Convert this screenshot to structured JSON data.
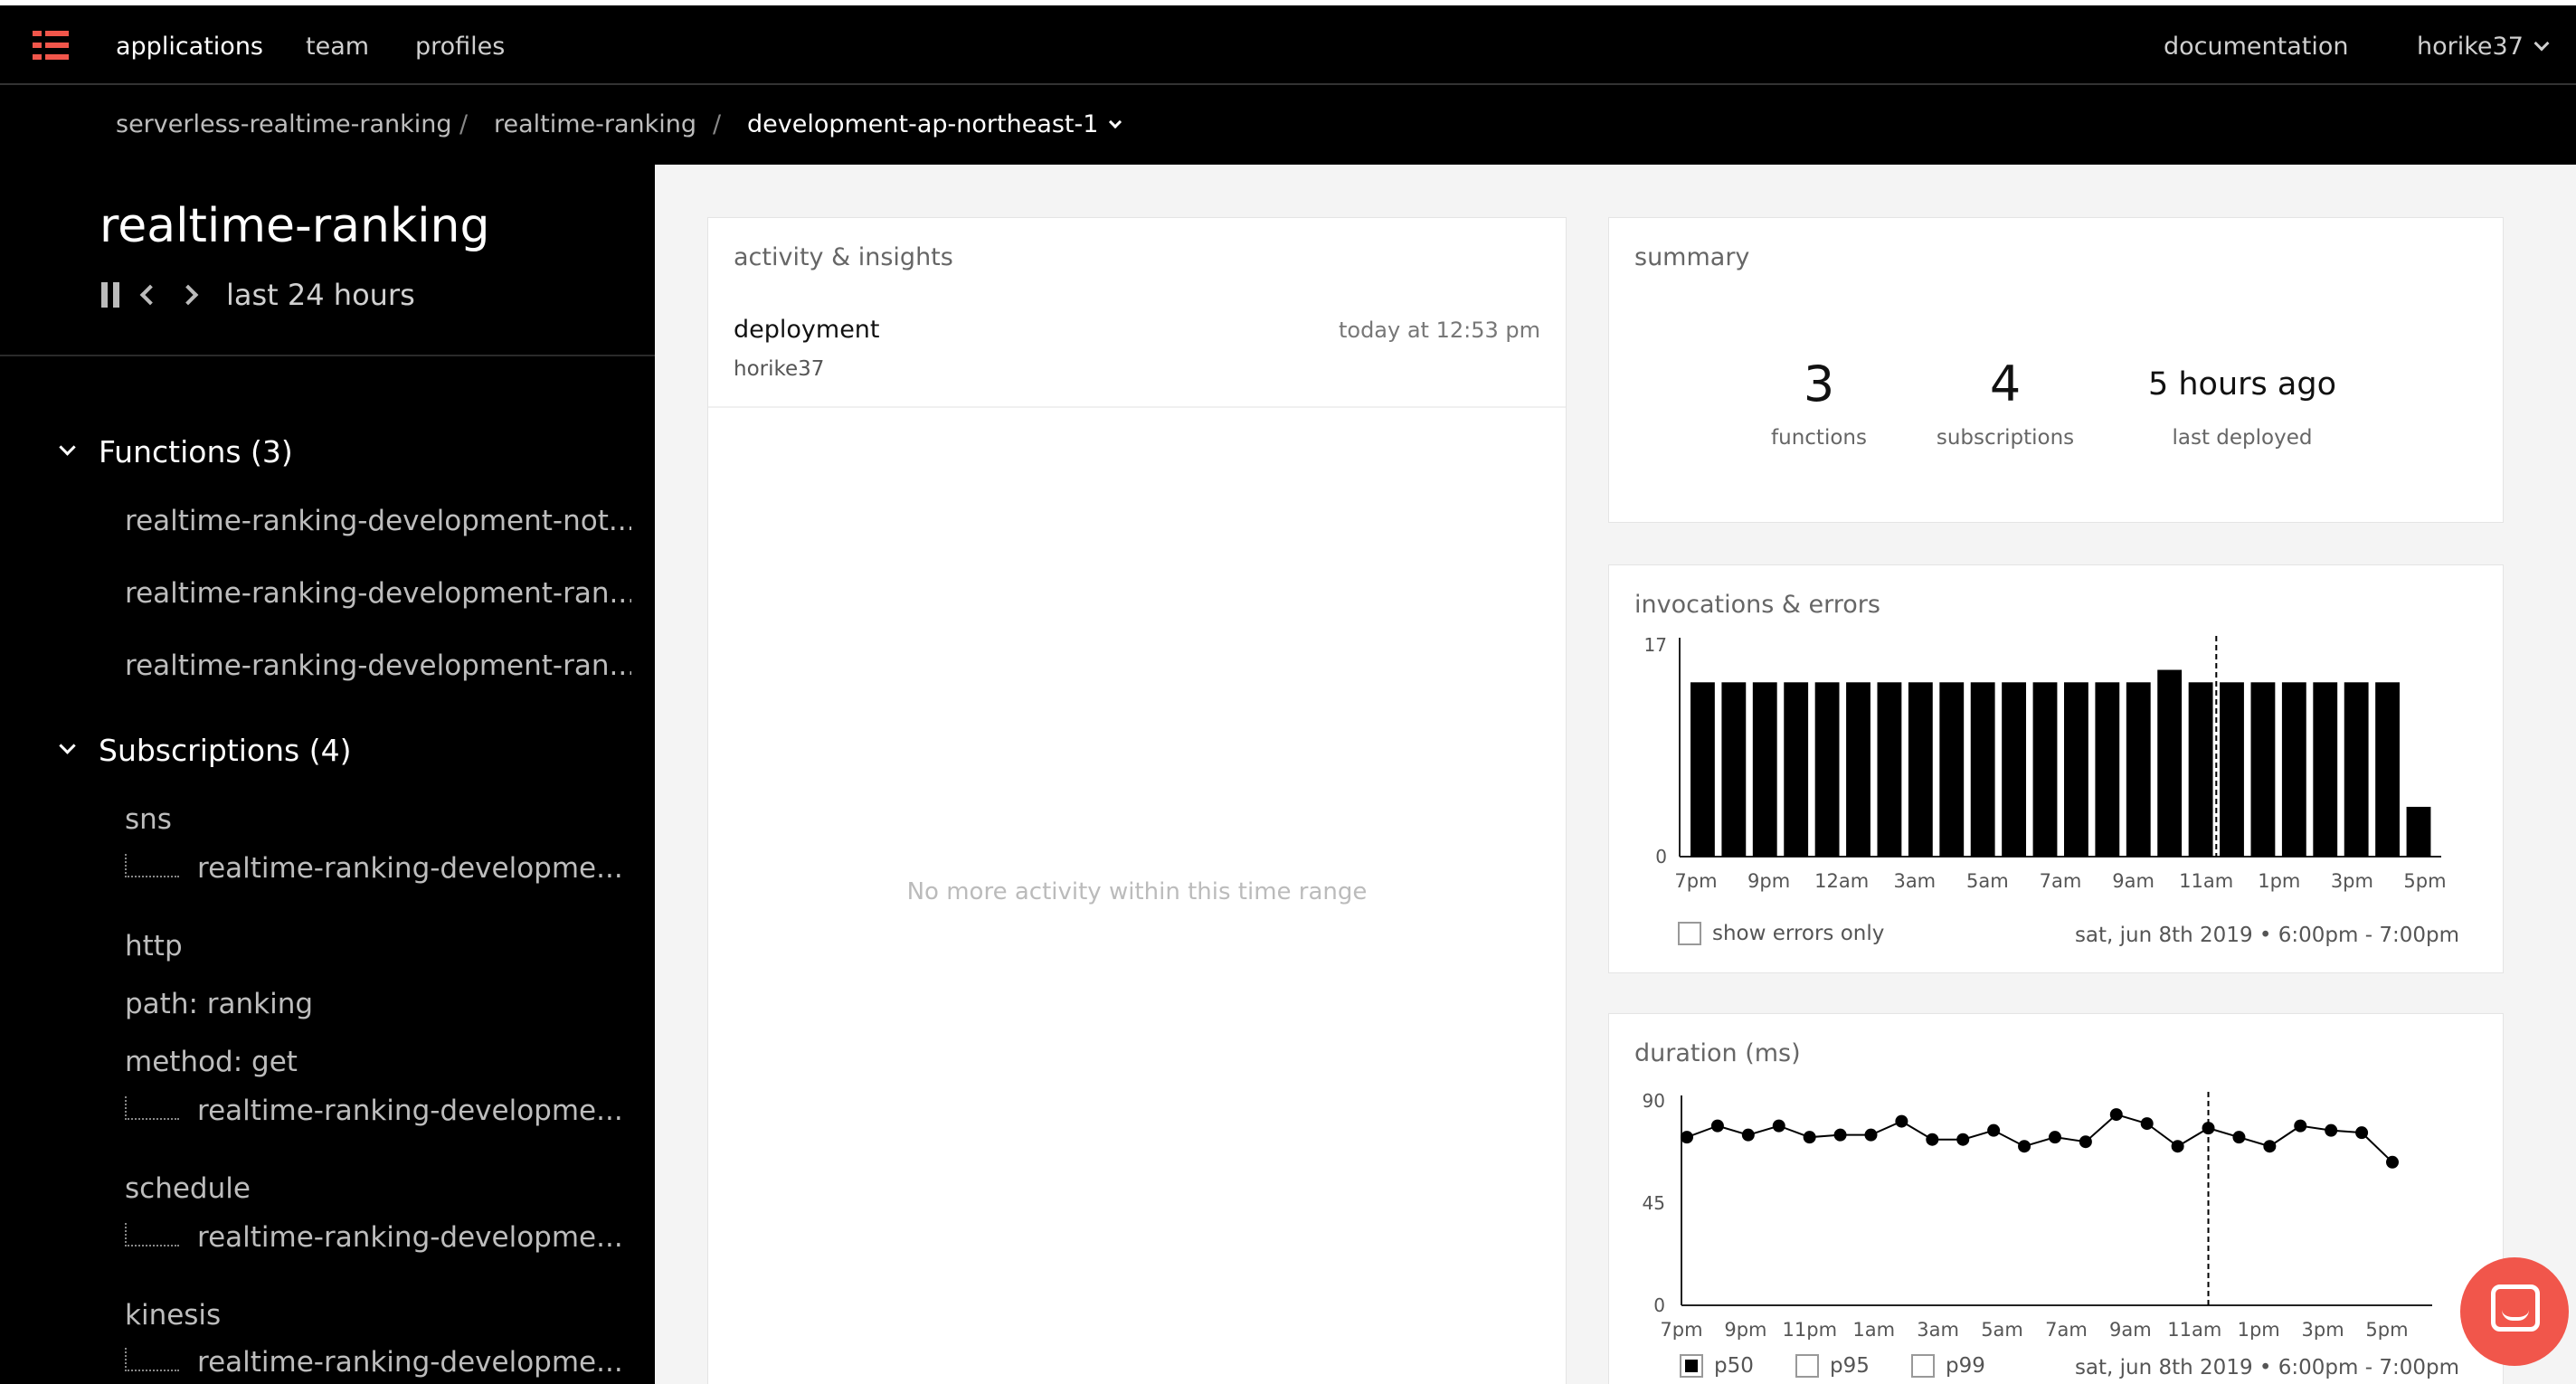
{
  "topbar": {
    "nav": [
      "applications",
      "team",
      "profiles"
    ],
    "documentation": "documentation",
    "user": "horike37",
    "logo_color": "#f1564b"
  },
  "breadcrumb": {
    "items": [
      "serverless-realtime-ranking",
      "realtime-ranking",
      "development-ap-northeast-1"
    ],
    "separator": "/"
  },
  "sidebar": {
    "title": "realtime-ranking",
    "range": "last 24 hours",
    "functions_header": "Functions (3)",
    "functions": [
      "realtime-ranking-development-not...",
      "realtime-ranking-development-ran...",
      "realtime-ranking-development-ran..."
    ],
    "subscriptions_header": "Subscriptions (4)",
    "subscriptions": {
      "sns": "sns",
      "sns_child": "realtime-ranking-developme...",
      "http": "http",
      "http_path": "path: ranking",
      "http_method": "method: get",
      "http_child": "realtime-ranking-developme...",
      "schedule": "schedule",
      "schedule_child": "realtime-ranking-developme...",
      "kinesis": "kinesis",
      "kinesis_child": "realtime-ranking-developme..."
    }
  },
  "activity": {
    "title": "activity & insights",
    "event": "deployment",
    "user": "horike37",
    "time": "today at 12:53 pm",
    "empty": "No more activity within this time range"
  },
  "summary": {
    "title": "summary",
    "functions_value": "3",
    "functions_label": "functions",
    "subscriptions_value": "4",
    "subscriptions_label": "subscriptions",
    "deployed_value": "5 hours ago",
    "deployed_label": "last deployed"
  },
  "invocations": {
    "title": "invocations & errors",
    "show_errors_label": "show errors only",
    "time_range": "sat, jun 8th 2019 • 6:00pm - 7:00pm"
  },
  "duration": {
    "title": "duration (ms)",
    "legend": [
      "p50",
      "p95",
      "p99"
    ],
    "time_range": "sat, jun 8th 2019 • 6:00pm - 7:00pm"
  },
  "chart_data": [
    {
      "type": "bar",
      "title": "invocations & errors",
      "ylim": [
        0,
        17
      ],
      "yticks": [
        "0",
        "17"
      ],
      "tick_labels": [
        "7pm",
        "9pm",
        "12am",
        "3am",
        "5am",
        "7am",
        "9am",
        "11am",
        "1pm",
        "3pm",
        "5pm"
      ],
      "values": [
        14,
        14,
        14,
        14,
        14,
        14,
        14,
        14,
        14,
        14,
        14,
        14,
        14,
        14,
        14,
        15,
        14,
        14,
        14,
        14,
        14,
        14,
        14,
        4
      ],
      "marker_index": 17
    },
    {
      "type": "line",
      "title": "duration (ms)",
      "ylim": [
        0,
        90
      ],
      "yticks": [
        "0",
        "45",
        "90"
      ],
      "tick_labels": [
        "7pm",
        "9pm",
        "11pm",
        "1am",
        "3am",
        "5am",
        "7am",
        "9am",
        "11am",
        "1pm",
        "3pm",
        "5pm"
      ],
      "series": [
        {
          "name": "p50",
          "values": [
            74,
            79,
            75,
            79,
            74,
            75,
            75,
            81,
            73,
            73,
            77,
            70,
            74,
            72,
            84,
            80,
            70,
            78,
            74,
            70,
            79,
            77,
            76,
            63
          ]
        }
      ],
      "marker_index": 17
    }
  ]
}
